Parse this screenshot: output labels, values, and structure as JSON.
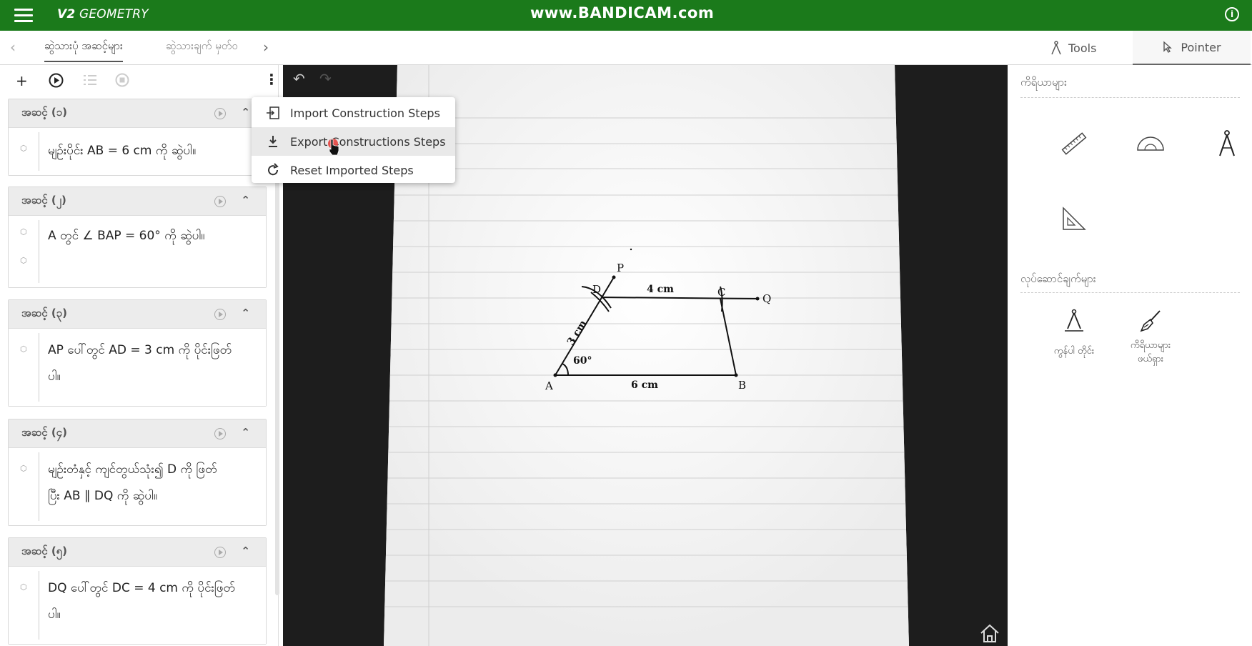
{
  "app": {
    "title_bold": "V2",
    "title_rest": " GEOMETRY",
    "watermark": "www.BANDICAM.com"
  },
  "tabs": {
    "active": "ဆွဲသားပုံ အဆင့်များ",
    "inactive": "ဆွဲသားချက် မှတ်ဝ",
    "tools": "Tools",
    "pointer": "Pointer"
  },
  "menu": {
    "import": "Import Construction Steps",
    "export": "Export Constructions Steps",
    "reset": "Reset Imported Steps"
  },
  "steps": [
    {
      "title": "အဆင့် (၁)",
      "lines": [
        "မျဉ်းပိုင်း AB = 6 cm ကို ဆွဲပါ။"
      ]
    },
    {
      "title": "အဆင့် (၂)",
      "lines": [
        "A တွင် ∠ BAP = 60° ကို ဆွဲပါ။"
      ]
    },
    {
      "title": "အဆင့် (၃)",
      "lines": [
        "AP ပေါ်တွင် AD = 3 cm ကို ပိုင်းဖြတ်",
        "ပါ။"
      ]
    },
    {
      "title": "အဆင့် (၄)",
      "lines": [
        "မျဉ်းတံနှင့် ကျင်တွယ်သုံး၍ D ကို ဖြတ်",
        "ပြီး AB ∥ DQ ကို ဆွဲပါ။"
      ]
    },
    {
      "title": "အဆင့် (၅)",
      "lines": [
        "DQ ပေါ်တွင် DC = 4 cm ကို ပိုင်းဖြတ်",
        "ပါ။"
      ]
    }
  ],
  "figure": {
    "A": "A",
    "B": "B",
    "C": "C",
    "D": "D",
    "P": "P",
    "Q": "Q",
    "ab": "6 cm",
    "dc": "4 cm",
    "ad": "3 cm",
    "angle": "60°"
  },
  "right": {
    "tools_title": "ကိရိယာများ",
    "actions_title": "လုပ်ဆောင်ချက်များ",
    "action1": "ကွန်ပါ တိုင်း",
    "action2a": "ကိရိယာများ",
    "action2b": "ဖယ်ရှား"
  }
}
